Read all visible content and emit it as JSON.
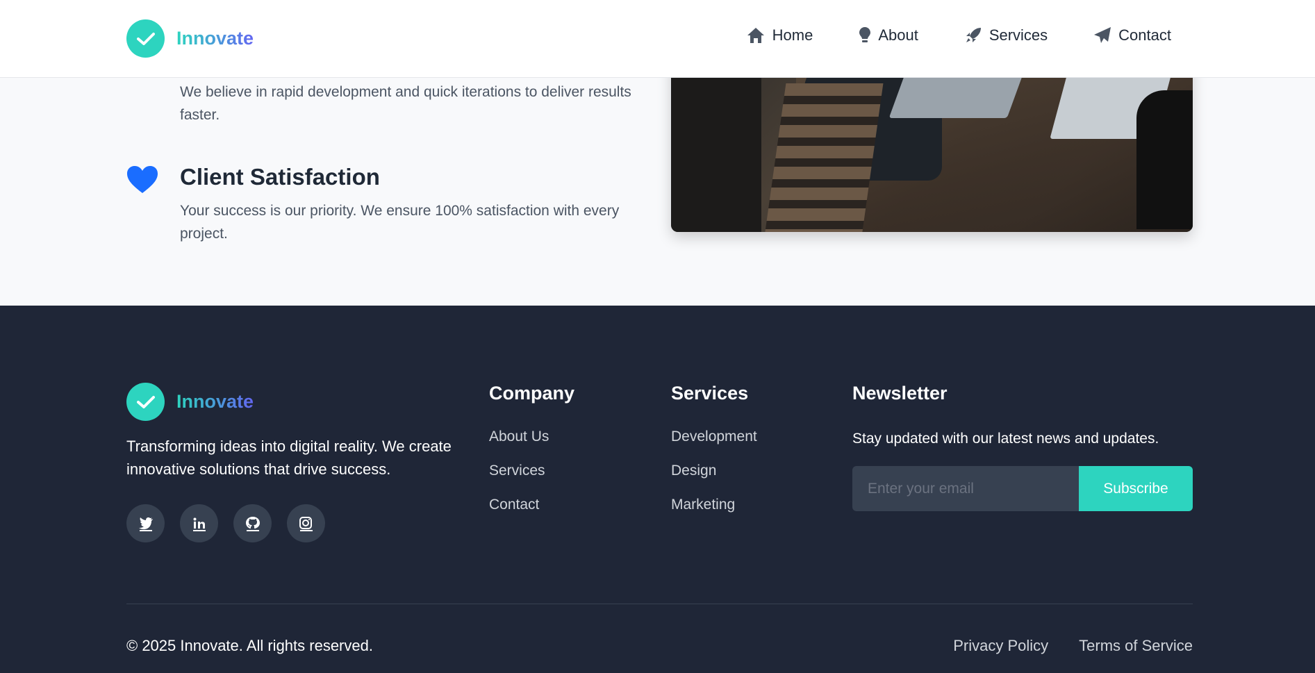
{
  "header": {
    "logo_text": "Innovate",
    "nav": [
      {
        "label": "Home",
        "icon": "home-icon"
      },
      {
        "label": "About",
        "icon": "lightbulb-icon"
      },
      {
        "label": "Services",
        "icon": "rocket-icon"
      },
      {
        "label": "Contact",
        "icon": "paper-plane-icon"
      }
    ]
  },
  "features": [
    {
      "title": "",
      "description": "We believe in rapid development and quick iterations to deliver results faster."
    },
    {
      "title": "Client Satisfaction",
      "description": "Your success is our priority. We ensure 100% satisfaction with every project.",
      "icon": "heart-icon"
    }
  ],
  "footer": {
    "logo_text": "Innovate",
    "description": "Transforming ideas into digital reality. We create innovative solutions that drive success.",
    "socials": [
      "twitter-icon",
      "linkedin-icon",
      "github-icon",
      "instagram-icon"
    ],
    "company": {
      "title": "Company",
      "links": [
        "About Us",
        "Services",
        "Contact"
      ]
    },
    "services": {
      "title": "Services",
      "links": [
        "Development",
        "Design",
        "Marketing"
      ]
    },
    "newsletter": {
      "title": "Newsletter",
      "text": "Stay updated with our latest news and updates.",
      "placeholder": "Enter your email",
      "button": "Subscribe"
    },
    "copyright": "© 2025 Innovate. All rights reserved.",
    "legal": [
      "Privacy Policy",
      "Terms of Service"
    ]
  },
  "colors": {
    "accent": "#2dd4bf",
    "heart": "#1a6dff",
    "footer_bg": "#1f2637"
  }
}
